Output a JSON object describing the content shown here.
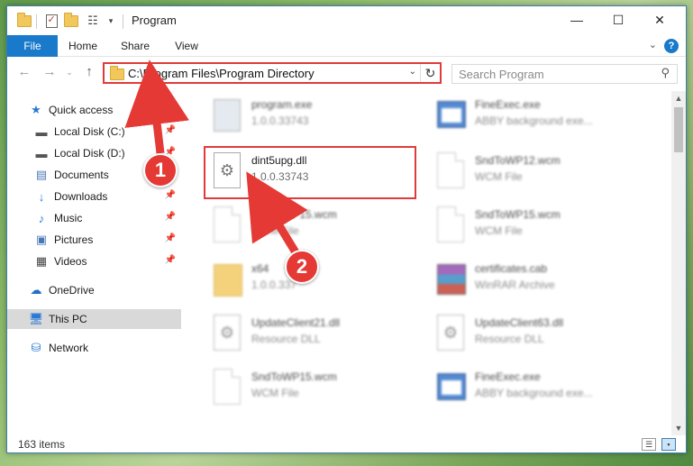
{
  "window": {
    "title": "Program",
    "controls": {
      "minimize": "—",
      "maximize": "☐",
      "close": "✕"
    }
  },
  "ribbon": {
    "tabs": [
      "File",
      "Home",
      "Share",
      "View"
    ],
    "help": "?"
  },
  "address": {
    "path": "C:\\Program Files\\Program Directory"
  },
  "search": {
    "placeholder": "Search Program"
  },
  "sidebar": {
    "items": [
      {
        "label": "Quick access",
        "icon": "star-icon"
      },
      {
        "label": "Local Disk (C:)",
        "icon": "drive-icon",
        "pinned": true
      },
      {
        "label": "Local Disk (D:)",
        "icon": "drive-icon",
        "pinned": true
      },
      {
        "label": "Documents",
        "icon": "documents-icon",
        "pinned": true
      },
      {
        "label": "Downloads",
        "icon": "download-icon",
        "pinned": true
      },
      {
        "label": "Music",
        "icon": "music-icon",
        "pinned": true
      },
      {
        "label": "Pictures",
        "icon": "pictures-icon",
        "pinned": true
      },
      {
        "label": "Videos",
        "icon": "videos-icon",
        "pinned": true
      },
      {
        "label": "OneDrive",
        "icon": "cloud-icon"
      },
      {
        "label": "This PC",
        "icon": "monitor-icon",
        "selected": true
      },
      {
        "label": "Network",
        "icon": "network-icon"
      }
    ]
  },
  "files": [
    {
      "name": "program.exe",
      "sub": "1.0.0.33743",
      "icon": "program-icon",
      "blurred": true
    },
    {
      "name": "FineExec.exe",
      "sub": "ABBY background exe...",
      "icon": "exe-icon",
      "blurred": true
    },
    {
      "name": "dint5upg.dll",
      "sub": "1.0.0.33743",
      "icon": "dll-gear-icon",
      "blurred": false,
      "highlighted": true
    },
    {
      "name": "SndToWP12.wcm",
      "sub": "WCM File",
      "icon": "document-icon",
      "blurred": true
    },
    {
      "name": "SndToWP15.wcm",
      "sub": "WCM File",
      "icon": "document-icon",
      "blurred": true
    },
    {
      "name": "SndToWP15.wcm",
      "sub": "WCM File",
      "icon": "document-icon",
      "blurred": true
    },
    {
      "name": "x64",
      "sub": "1.0.0.337",
      "icon": "folder-icon",
      "blurred": true
    },
    {
      "name": "certificates.cab",
      "sub": "WinRAR Archive",
      "icon": "winrar-icon",
      "blurred": true
    },
    {
      "name": "UpdateClient21.dll",
      "sub": "Resource DLL",
      "icon": "dll-gear-icon",
      "blurred": true
    },
    {
      "name": "UpdateClient63.dll",
      "sub": "Resource DLL",
      "icon": "dll-gear-icon",
      "blurred": true
    },
    {
      "name": "SndToWP15.wcm",
      "sub": "WCM File",
      "icon": "document-icon",
      "blurred": true
    },
    {
      "name": "FineExec.exe",
      "sub": "ABBY background exe...",
      "icon": "exe-icon",
      "blurred": true
    }
  ],
  "status": {
    "items_count": "163 items"
  },
  "annotations": [
    {
      "number": "1",
      "color": "#e53935"
    },
    {
      "number": "2",
      "color": "#e53935"
    }
  ]
}
